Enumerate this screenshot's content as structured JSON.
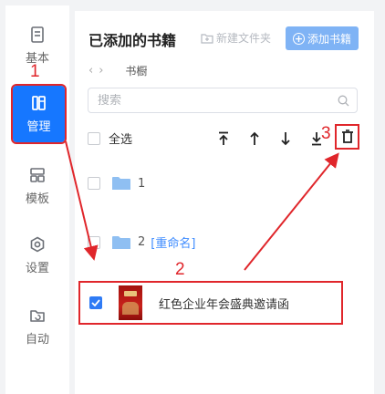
{
  "sidebar": {
    "items": [
      {
        "label": "基本",
        "icon": "document-icon"
      },
      {
        "label": "管理",
        "icon": "books-icon",
        "active": true
      },
      {
        "label": "模板",
        "icon": "template-icon"
      },
      {
        "label": "设置",
        "icon": "settings-hexagon-icon"
      },
      {
        "label": "自动",
        "icon": "auto-folder-icon"
      }
    ]
  },
  "panel": {
    "title": "已添加的书籍",
    "new_folder_label": "新建文件夹",
    "add_book_label": "添加书籍",
    "breadcrumb": {
      "back": "‹",
      "forward": "›",
      "current": "书橱"
    },
    "search": {
      "placeholder": "搜索",
      "value": ""
    },
    "select_all_label": "全选",
    "toolbar_icons": [
      "move-top-icon",
      "move-up-icon",
      "move-down-icon",
      "move-bottom-icon",
      "trash-icon"
    ],
    "folders": [
      {
        "name": "1",
        "tag": ""
      },
      {
        "name": "2",
        "tag": "[重命名]"
      }
    ],
    "book": {
      "title": "红色企业年会盛典邀请函",
      "checked": true
    }
  },
  "annotations": {
    "step1": "1",
    "step2": "2",
    "step3": "3",
    "color": "#e0262b"
  },
  "colors": {
    "accent": "#1677ff",
    "add_button": "#7fb3f5",
    "folder": "#8fbff2",
    "link": "#3f8cff"
  }
}
